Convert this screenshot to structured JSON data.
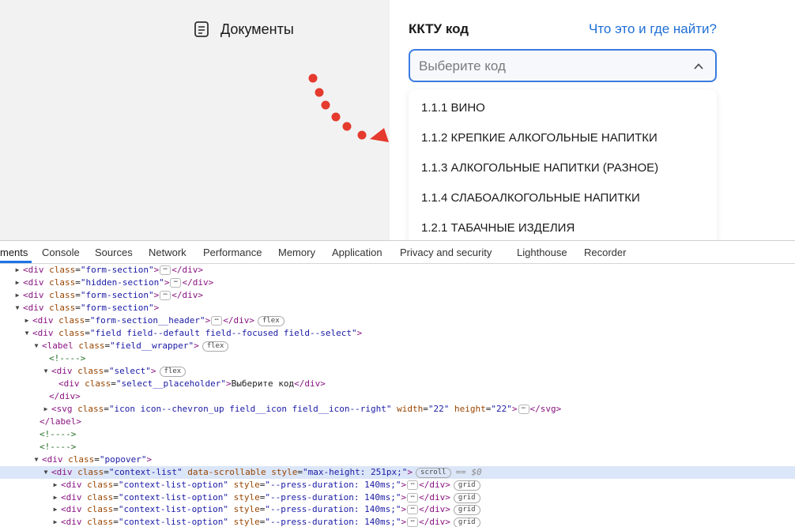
{
  "left_panel": {
    "documents_label": "Документы"
  },
  "field": {
    "title": "ККТУ код",
    "help_link": "Что это и где найти?",
    "placeholder": "Выберите код"
  },
  "options": [
    "1.1.1 ВИНО",
    "1.1.2 КРЕПКИЕ АЛКОГОЛЬНЫЕ НАПИТКИ",
    "1.1.3 АЛКОГОЛЬНЫЕ НАПИТКИ (РАЗНОЕ)",
    "1.1.4 СЛАБОАЛКОГОЛЬНЫЕ НАПИТКИ",
    "1.2.1 ТАБАЧНЫЕ ИЗДЕЛИЯ"
  ],
  "devtools": {
    "tabs": [
      "ments",
      "Console",
      "Sources",
      "Network",
      "Performance",
      "Memory",
      "Application",
      "Privacy and security",
      "Lighthouse",
      "Recorder"
    ],
    "active_tab": "ments",
    "code": {
      "lt": "<",
      "gt": ">",
      "lt_slash": "</",
      "eq": "=",
      "q": "\"",
      "sp": " ",
      "comment": "<!---->",
      "div": "div",
      "label": "label",
      "svg": "svg",
      "cls": "class",
      "style": "style",
      "width": "width",
      "height": "height",
      "data_scrollable": "data-scrollable",
      "v_form_section": "form-section",
      "v_hidden_section": "hidden-section",
      "v_form_section_header": "form-section__header",
      "v_field": "field field--default field--focused field--select",
      "v_field_wrapper": "field__wrapper",
      "v_select": "select",
      "v_select_placeholder": "select__placeholder",
      "placeholder_text": "Выберите код",
      "v_icon": "icon icon--chevron_up field__icon field__icon--right",
      "v_22": "22",
      "v_popover": "popover",
      "v_context_list": "context-list",
      "v_maxheight": "max-height: 251px;",
      "v_context_list_option": "context-list-option",
      "v_press": "--press-duration: 140ms;",
      "ellipsis": "⋯",
      "badge_flex": "flex",
      "badge_grid": "grid",
      "badge_scroll": "scroll",
      "eq_eq": "==",
      "dollar0": "$0"
    }
  }
}
